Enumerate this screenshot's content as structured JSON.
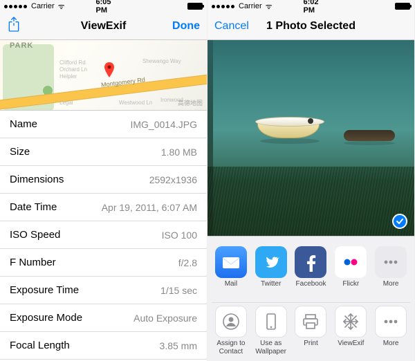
{
  "left": {
    "carrier": "Carrier",
    "wifi": "ᯤ",
    "time": "6:05 PM",
    "title": "ViewExif",
    "done": "Done",
    "map": {
      "park_label": "PARK",
      "road_label": "Montgomery Rd",
      "street_labels": [
        "Clifford Rd",
        "Orchard Ln",
        "Helpler",
        "Legal",
        "Shewango Way",
        "Ironwood",
        "Westwood Ln"
      ],
      "cjk": "高德地图"
    },
    "fields": [
      {
        "k": "Name",
        "v": "IMG_0014.JPG"
      },
      {
        "k": "Size",
        "v": "1.80 MB"
      },
      {
        "k": "Dimensions",
        "v": "2592x1936"
      },
      {
        "k": "Date Time",
        "v": "Apr 19, 2011, 6:07 AM"
      },
      {
        "k": "ISO Speed",
        "v": "ISO 100"
      },
      {
        "k": "F Number",
        "v": "f/2.8"
      },
      {
        "k": "Exposure Time",
        "v": "1/15 sec"
      },
      {
        "k": "Exposure Mode",
        "v": "Auto Exposure"
      },
      {
        "k": "Focal Length",
        "v": "3.85 mm"
      }
    ]
  },
  "right": {
    "carrier": "Carrier",
    "time": "6:02 PM",
    "cancel": "Cancel",
    "title": "1 Photo Selected",
    "share_row1": [
      {
        "id": "mail",
        "label": "Mail"
      },
      {
        "id": "twitter",
        "label": "Twitter"
      },
      {
        "id": "facebook",
        "label": "Facebook"
      },
      {
        "id": "flickr",
        "label": "Flickr"
      },
      {
        "id": "more1",
        "label": "More"
      }
    ],
    "share_row2": [
      {
        "id": "assign",
        "label": "Assign to Contact"
      },
      {
        "id": "wallpaper",
        "label": "Use as Wallpaper"
      },
      {
        "id": "print",
        "label": "Print"
      },
      {
        "id": "viewexif",
        "label": "ViewExif"
      },
      {
        "id": "more2",
        "label": "More"
      }
    ]
  }
}
